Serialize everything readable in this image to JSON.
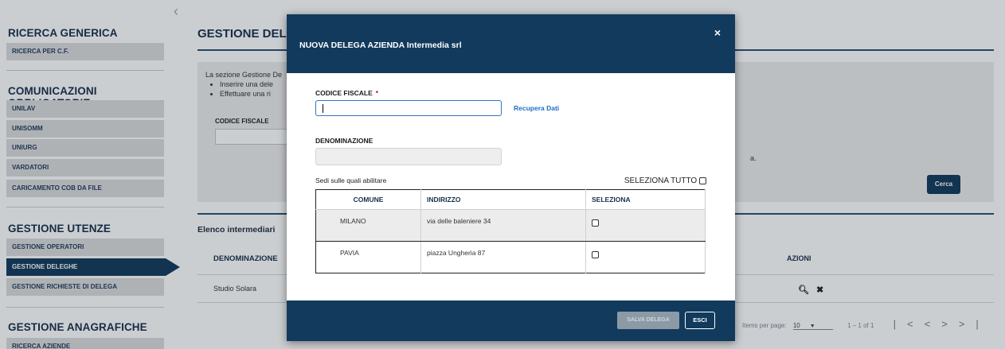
{
  "sidebar": {
    "collapse_glyph": "‹",
    "sections": [
      {
        "title": "RICERCA GENERICA",
        "items": [
          "RICERCA PER C.F."
        ]
      },
      {
        "title": "COMUNICAZIONI OBBLIGATORIE",
        "items": [
          "UNILAV",
          "UNISOMM",
          "UNIURG",
          "VARDATORI",
          "CARICAMENTO COB DA FILE"
        ]
      },
      {
        "title": "GESTIONE UTENZE",
        "items": [
          "GESTIONE OPERATORI",
          "GESTIONE DELEGHE",
          "GESTIONE RICHIESTE DI DELEGA"
        ],
        "active": "GESTIONE DELEGHE"
      },
      {
        "title": "GESTIONE ANAGRAFICHE",
        "items": [
          "RICERCA AZIENDE"
        ]
      }
    ]
  },
  "main": {
    "title": "GESTIONE DELEGH",
    "info_intro": "La sezione Gestione De",
    "info_bullets": [
      "Inserire una dele",
      "Effettuare una ri"
    ],
    "info_trail": "a.",
    "codice_fiscale_label": "CODICE FISCALE",
    "search_button": "Cerca",
    "list_title": "Elenco intermediari",
    "columns": {
      "denominazione": "DENOMINAZIONE",
      "azioni": "AZIONI"
    },
    "rows": [
      {
        "denominazione": "Studio Solara"
      }
    ],
    "pager": {
      "items_per_page_label": "Items per page:",
      "items_per_page_value": "10",
      "range": "1 – 1 of 1"
    }
  },
  "modal": {
    "title": "NUOVA DELEGA AZIENDA Intermedia srl",
    "close_glyph": "×",
    "codice_fiscale_label": "CODICE FISCALE",
    "required_mark": "*",
    "codice_fiscale_value": "",
    "recupera_label": "Recupera Dati",
    "denominazione_label": "DENOMINAZIONE",
    "denominazione_value": "",
    "sedi_label": "Sedi sulle quali abilitare",
    "select_all_label": "SELEZIONA TUTTO",
    "table": {
      "headers": [
        "COMUNE",
        "INDIRIZZO",
        "SELEZIONA"
      ],
      "rows": [
        {
          "comune": "MILANO",
          "indirizzo": "via delle baleniere 34",
          "selected": false
        },
        {
          "comune": "PAVIA",
          "indirizzo": "piazza Ungheria 87",
          "selected": false
        }
      ]
    },
    "save_label": "SALVA DELEGA",
    "exit_label": "ESCI"
  },
  "colors": {
    "primary": "#123a5c",
    "link": "#1f6fc2",
    "required": "#d0002b",
    "sidebar_item_bg": "#dcdcdc"
  }
}
